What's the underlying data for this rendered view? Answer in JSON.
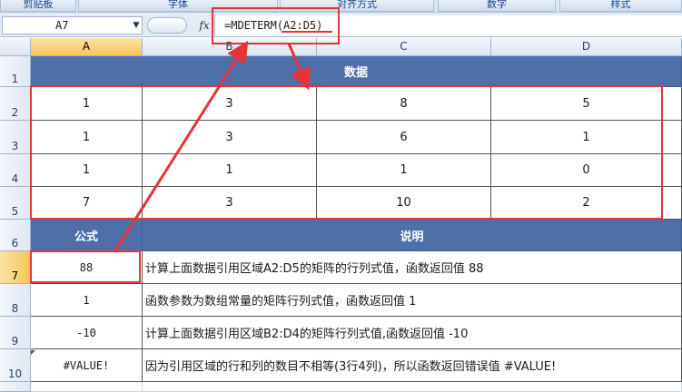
{
  "ribbon": {
    "groups": [
      "剪贴板",
      "字体",
      "对齐方式",
      "数字",
      "样式"
    ]
  },
  "formula_bar": {
    "name_box": "A7",
    "fx_label": "fx",
    "formula": "=MDETERM(A2:D5)"
  },
  "columns": [
    "A",
    "B",
    "C",
    "D"
  ],
  "rows": [
    "1",
    "2",
    "3",
    "4",
    "5",
    "6",
    "7",
    "8",
    "9",
    "10"
  ],
  "sheet": {
    "data_header": "数据",
    "data": [
      [
        "1",
        "3",
        "8",
        "5"
      ],
      [
        "1",
        "3",
        "6",
        "1"
      ],
      [
        "1",
        "1",
        "1",
        "0"
      ],
      [
        "7",
        "3",
        "10",
        "2"
      ]
    ],
    "formula_header": "公式",
    "desc_header": "说明",
    "examples": [
      {
        "result": "88",
        "desc": "计算上面数据引用区域A2:D5的矩阵的行列式值，函数返回值 88"
      },
      {
        "result": "1",
        "desc": "函数参数为数组常量的矩阵行列式值，函数返回值 1"
      },
      {
        "result": "-10",
        "desc": "计算上面数据引用区域B2:D4的矩阵行列式值,函数返回值 -10"
      },
      {
        "result": "#VALUE!",
        "desc": "因为引用区域的行和列的数目不相等(3行4列)，所以函数返回错误值 #VALUE!"
      }
    ]
  },
  "colors": {
    "header_fill": "#4f6fa8",
    "annotation_red": "#e8323a"
  }
}
